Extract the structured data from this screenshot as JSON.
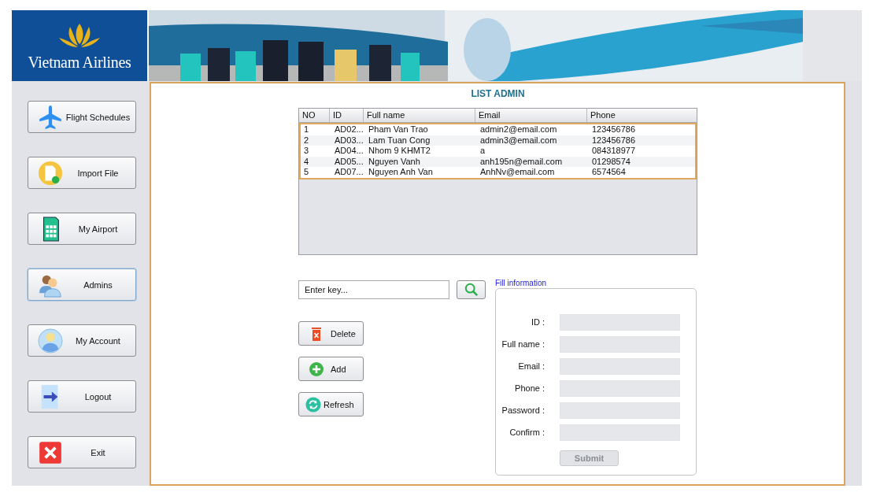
{
  "logo": {
    "text": "Vietnam Airlines"
  },
  "sidebar": {
    "items": [
      {
        "label": "Flight Schedules",
        "kind": "plane",
        "selected": false
      },
      {
        "label": "Import File",
        "kind": "file",
        "selected": false
      },
      {
        "label": "My Airport",
        "kind": "grid",
        "selected": false
      },
      {
        "label": "Admins",
        "kind": "users",
        "selected": true
      },
      {
        "label": "My Account",
        "kind": "user",
        "selected": false
      },
      {
        "label": "Logout",
        "kind": "arrow",
        "selected": false
      },
      {
        "label": "Exit",
        "kind": "exit",
        "selected": false
      }
    ]
  },
  "title": "LIST ADMIN",
  "table": {
    "columns": [
      "NO",
      "ID",
      "Full name",
      "Email",
      "Phone"
    ],
    "rows": [
      [
        "1",
        "AD02...",
        "Pham Van Trao",
        "admin2@email.com",
        "123456786"
      ],
      [
        "2",
        "AD03...",
        "Lam Tuan Cong",
        "admin3@email.com",
        "123456786"
      ],
      [
        "3",
        "AD04...",
        "Nhom 9 KHMT2",
        "a",
        "084318977"
      ],
      [
        "4",
        "AD05...",
        "Nguyen Vanh",
        "anh195n@email.com",
        "01298574"
      ],
      [
        "5",
        "AD07...",
        "Nguyen Anh Van",
        "AnhNv@email.com",
        "6574564"
      ]
    ]
  },
  "search": {
    "placeholder": "Enter key..."
  },
  "actions": [
    {
      "label": "Delete",
      "kind": "delete"
    },
    {
      "label": "Add",
      "kind": "add"
    },
    {
      "label": "Refresh",
      "kind": "refresh"
    }
  ],
  "form": {
    "title": "Fill information",
    "fields": [
      {
        "label": "ID :"
      },
      {
        "label": "Full name :"
      },
      {
        "label": "Email :"
      },
      {
        "label": "Phone :"
      },
      {
        "label": "Password :"
      },
      {
        "label": "Confirm :"
      }
    ],
    "submit": {
      "label": "Submit",
      "disabled": true
    }
  }
}
